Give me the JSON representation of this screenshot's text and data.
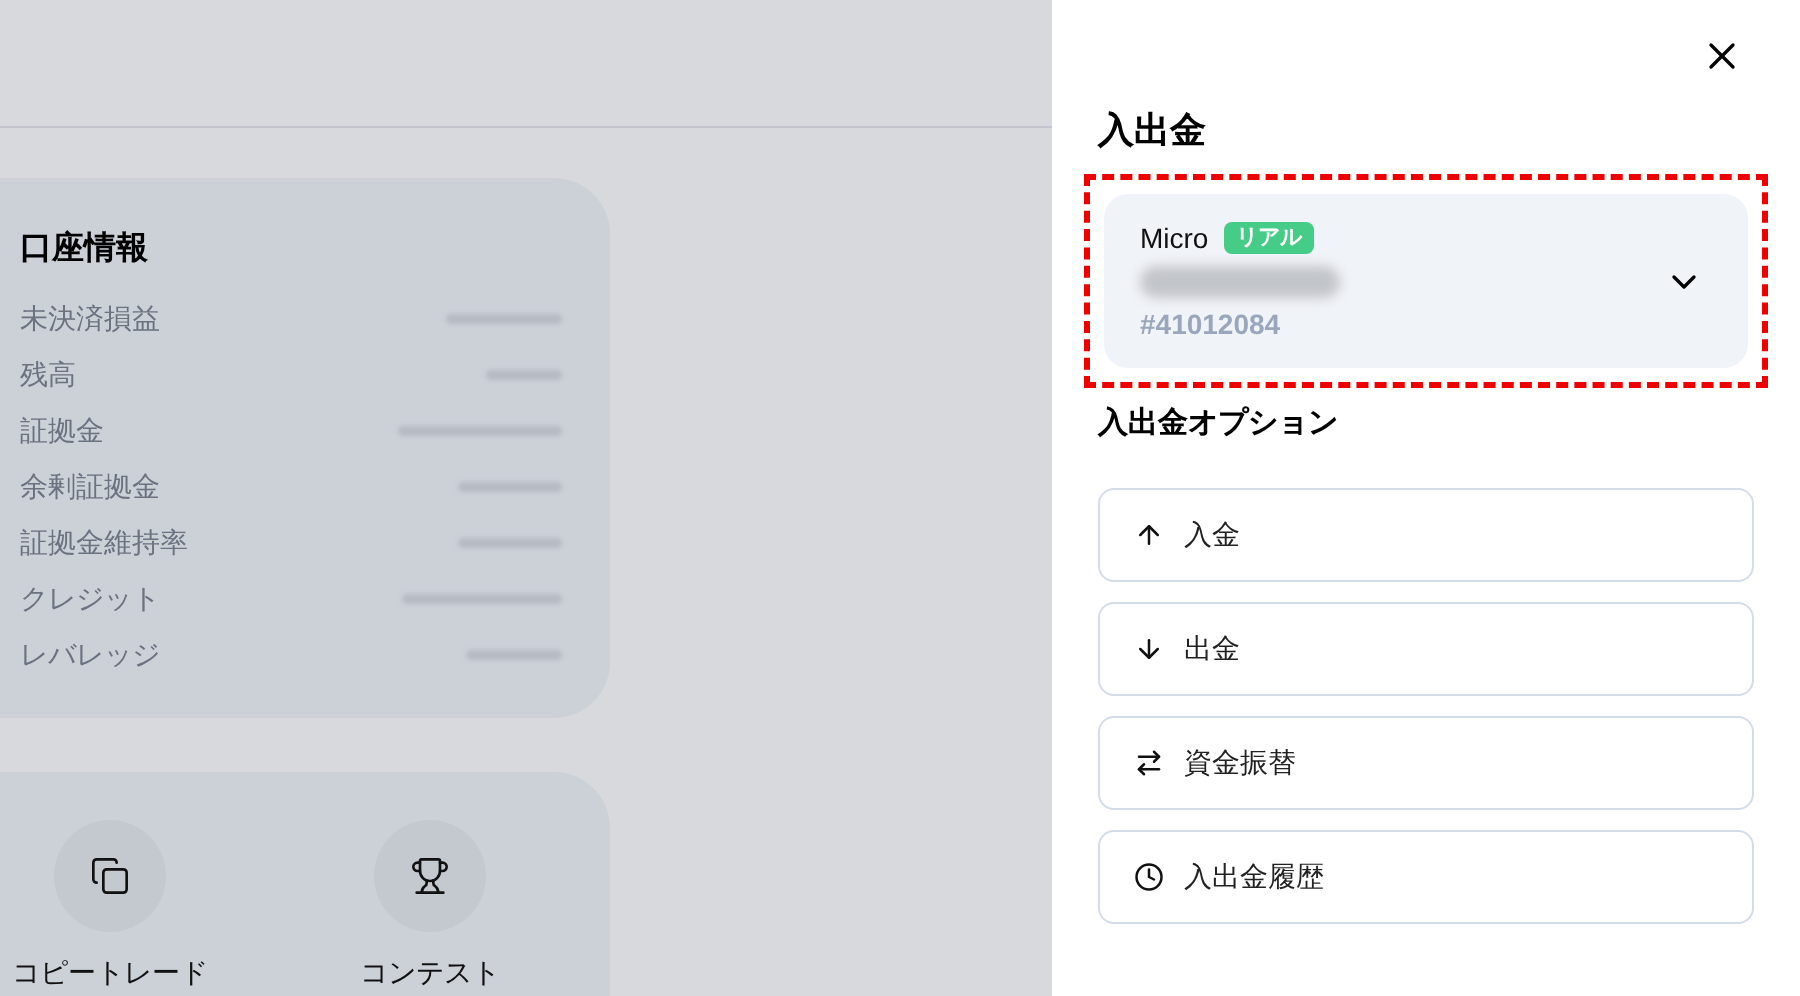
{
  "account_info": {
    "title": "口座情報",
    "rows": [
      {
        "label": "未決済損益"
      },
      {
        "label": "残高"
      },
      {
        "label": "証拠金"
      },
      {
        "label": "余剰証拠金"
      },
      {
        "label": "証拠金維持率"
      },
      {
        "label": "クレジット"
      },
      {
        "label": "レバレッジ"
      }
    ]
  },
  "shortcuts": [
    {
      "kind": "copy",
      "label": "コピートレード"
    },
    {
      "kind": "trophy",
      "label": "コンテスト"
    }
  ],
  "drawer": {
    "title": "入出金",
    "account": {
      "type": "Micro",
      "badge": "リアル",
      "number": "#41012084",
      "highlighted": true
    },
    "options_title": "入出金オプション",
    "options": [
      {
        "kind": "up",
        "label": "入金"
      },
      {
        "kind": "down",
        "label": "出金"
      },
      {
        "kind": "transfer",
        "label": "資金振替"
      },
      {
        "kind": "history",
        "label": "入出金履歴"
      }
    ]
  }
}
